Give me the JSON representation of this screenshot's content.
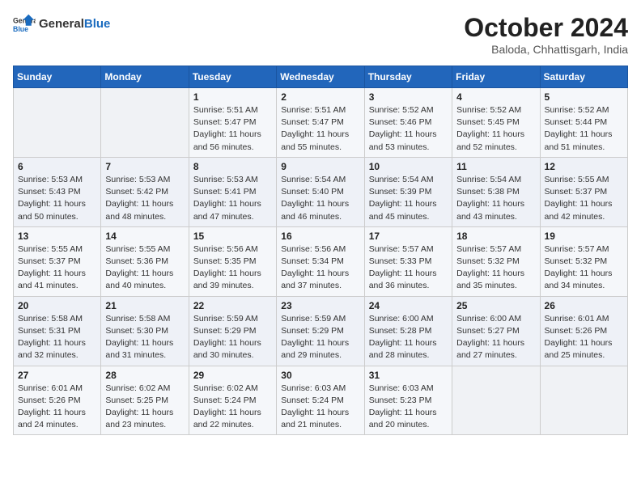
{
  "header": {
    "logo_general": "General",
    "logo_blue": "Blue",
    "month_title": "October 2024",
    "location": "Baloda, Chhattisgarh, India"
  },
  "days_of_week": [
    "Sunday",
    "Monday",
    "Tuesday",
    "Wednesday",
    "Thursday",
    "Friday",
    "Saturday"
  ],
  "weeks": [
    [
      {
        "day": "",
        "sunrise": "",
        "sunset": "",
        "daylight": ""
      },
      {
        "day": "",
        "sunrise": "",
        "sunset": "",
        "daylight": ""
      },
      {
        "day": "1",
        "sunrise": "Sunrise: 5:51 AM",
        "sunset": "Sunset: 5:47 PM",
        "daylight": "Daylight: 11 hours and 56 minutes."
      },
      {
        "day": "2",
        "sunrise": "Sunrise: 5:51 AM",
        "sunset": "Sunset: 5:47 PM",
        "daylight": "Daylight: 11 hours and 55 minutes."
      },
      {
        "day": "3",
        "sunrise": "Sunrise: 5:52 AM",
        "sunset": "Sunset: 5:46 PM",
        "daylight": "Daylight: 11 hours and 53 minutes."
      },
      {
        "day": "4",
        "sunrise": "Sunrise: 5:52 AM",
        "sunset": "Sunset: 5:45 PM",
        "daylight": "Daylight: 11 hours and 52 minutes."
      },
      {
        "day": "5",
        "sunrise": "Sunrise: 5:52 AM",
        "sunset": "Sunset: 5:44 PM",
        "daylight": "Daylight: 11 hours and 51 minutes."
      }
    ],
    [
      {
        "day": "6",
        "sunrise": "Sunrise: 5:53 AM",
        "sunset": "Sunset: 5:43 PM",
        "daylight": "Daylight: 11 hours and 50 minutes."
      },
      {
        "day": "7",
        "sunrise": "Sunrise: 5:53 AM",
        "sunset": "Sunset: 5:42 PM",
        "daylight": "Daylight: 11 hours and 48 minutes."
      },
      {
        "day": "8",
        "sunrise": "Sunrise: 5:53 AM",
        "sunset": "Sunset: 5:41 PM",
        "daylight": "Daylight: 11 hours and 47 minutes."
      },
      {
        "day": "9",
        "sunrise": "Sunrise: 5:54 AM",
        "sunset": "Sunset: 5:40 PM",
        "daylight": "Daylight: 11 hours and 46 minutes."
      },
      {
        "day": "10",
        "sunrise": "Sunrise: 5:54 AM",
        "sunset": "Sunset: 5:39 PM",
        "daylight": "Daylight: 11 hours and 45 minutes."
      },
      {
        "day": "11",
        "sunrise": "Sunrise: 5:54 AM",
        "sunset": "Sunset: 5:38 PM",
        "daylight": "Daylight: 11 hours and 43 minutes."
      },
      {
        "day": "12",
        "sunrise": "Sunrise: 5:55 AM",
        "sunset": "Sunset: 5:37 PM",
        "daylight": "Daylight: 11 hours and 42 minutes."
      }
    ],
    [
      {
        "day": "13",
        "sunrise": "Sunrise: 5:55 AM",
        "sunset": "Sunset: 5:37 PM",
        "daylight": "Daylight: 11 hours and 41 minutes."
      },
      {
        "day": "14",
        "sunrise": "Sunrise: 5:55 AM",
        "sunset": "Sunset: 5:36 PM",
        "daylight": "Daylight: 11 hours and 40 minutes."
      },
      {
        "day": "15",
        "sunrise": "Sunrise: 5:56 AM",
        "sunset": "Sunset: 5:35 PM",
        "daylight": "Daylight: 11 hours and 39 minutes."
      },
      {
        "day": "16",
        "sunrise": "Sunrise: 5:56 AM",
        "sunset": "Sunset: 5:34 PM",
        "daylight": "Daylight: 11 hours and 37 minutes."
      },
      {
        "day": "17",
        "sunrise": "Sunrise: 5:57 AM",
        "sunset": "Sunset: 5:33 PM",
        "daylight": "Daylight: 11 hours and 36 minutes."
      },
      {
        "day": "18",
        "sunrise": "Sunrise: 5:57 AM",
        "sunset": "Sunset: 5:32 PM",
        "daylight": "Daylight: 11 hours and 35 minutes."
      },
      {
        "day": "19",
        "sunrise": "Sunrise: 5:57 AM",
        "sunset": "Sunset: 5:32 PM",
        "daylight": "Daylight: 11 hours and 34 minutes."
      }
    ],
    [
      {
        "day": "20",
        "sunrise": "Sunrise: 5:58 AM",
        "sunset": "Sunset: 5:31 PM",
        "daylight": "Daylight: 11 hours and 32 minutes."
      },
      {
        "day": "21",
        "sunrise": "Sunrise: 5:58 AM",
        "sunset": "Sunset: 5:30 PM",
        "daylight": "Daylight: 11 hours and 31 minutes."
      },
      {
        "day": "22",
        "sunrise": "Sunrise: 5:59 AM",
        "sunset": "Sunset: 5:29 PM",
        "daylight": "Daylight: 11 hours and 30 minutes."
      },
      {
        "day": "23",
        "sunrise": "Sunrise: 5:59 AM",
        "sunset": "Sunset: 5:29 PM",
        "daylight": "Daylight: 11 hours and 29 minutes."
      },
      {
        "day": "24",
        "sunrise": "Sunrise: 6:00 AM",
        "sunset": "Sunset: 5:28 PM",
        "daylight": "Daylight: 11 hours and 28 minutes."
      },
      {
        "day": "25",
        "sunrise": "Sunrise: 6:00 AM",
        "sunset": "Sunset: 5:27 PM",
        "daylight": "Daylight: 11 hours and 27 minutes."
      },
      {
        "day": "26",
        "sunrise": "Sunrise: 6:01 AM",
        "sunset": "Sunset: 5:26 PM",
        "daylight": "Daylight: 11 hours and 25 minutes."
      }
    ],
    [
      {
        "day": "27",
        "sunrise": "Sunrise: 6:01 AM",
        "sunset": "Sunset: 5:26 PM",
        "daylight": "Daylight: 11 hours and 24 minutes."
      },
      {
        "day": "28",
        "sunrise": "Sunrise: 6:02 AM",
        "sunset": "Sunset: 5:25 PM",
        "daylight": "Daylight: 11 hours and 23 minutes."
      },
      {
        "day": "29",
        "sunrise": "Sunrise: 6:02 AM",
        "sunset": "Sunset: 5:24 PM",
        "daylight": "Daylight: 11 hours and 22 minutes."
      },
      {
        "day": "30",
        "sunrise": "Sunrise: 6:03 AM",
        "sunset": "Sunset: 5:24 PM",
        "daylight": "Daylight: 11 hours and 21 minutes."
      },
      {
        "day": "31",
        "sunrise": "Sunrise: 6:03 AM",
        "sunset": "Sunset: 5:23 PM",
        "daylight": "Daylight: 11 hours and 20 minutes."
      },
      {
        "day": "",
        "sunrise": "",
        "sunset": "",
        "daylight": ""
      },
      {
        "day": "",
        "sunrise": "",
        "sunset": "",
        "daylight": ""
      }
    ]
  ]
}
